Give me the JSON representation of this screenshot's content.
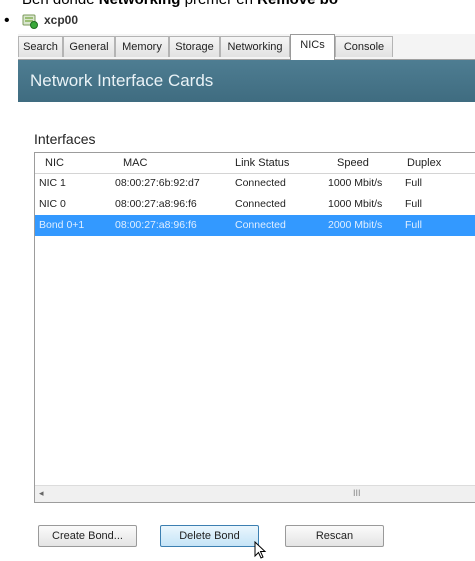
{
  "caption": {
    "prefix": "Ben donde ",
    "bold1": "Networking",
    "middle": " premer en ",
    "bold2": "Remove bo"
  },
  "window": {
    "host_name": "xcp00"
  },
  "tabs": [
    "Search",
    "General",
    "Memory",
    "Storage",
    "Networking",
    "NICs",
    "Console"
  ],
  "active_tab": "NICs",
  "banner": {
    "title": "Network Interface Cards"
  },
  "interfaces": {
    "label": "Interfaces",
    "columns": [
      "NIC",
      "MAC",
      "Link Status",
      "Speed",
      "Duplex"
    ],
    "rows": [
      {
        "nic": "NIC 1",
        "mac": "08:00:27:6b:92:d7",
        "status": "Connected",
        "speed": "1000 Mbit/s",
        "duplex": "Full"
      },
      {
        "nic": "NIC 0",
        "mac": "08:00:27:a8:96:f6",
        "status": "Connected",
        "speed": "1000 Mbit/s",
        "duplex": "Full"
      },
      {
        "nic": "Bond 0+1",
        "mac": "08:00:27:a8:96:f6",
        "status": "Connected",
        "speed": "2000 Mbit/s",
        "duplex": "Full"
      }
    ],
    "selected_row": "Bond 0+1",
    "scroll_grip": "III"
  },
  "buttons": {
    "create_bond": "Create Bond...",
    "delete_bond": "Delete Bond",
    "rescan": "Rescan"
  },
  "colors": {
    "banner": "#4a788d",
    "selection": "#3399ff",
    "button_hover": "#c5e4f7"
  }
}
